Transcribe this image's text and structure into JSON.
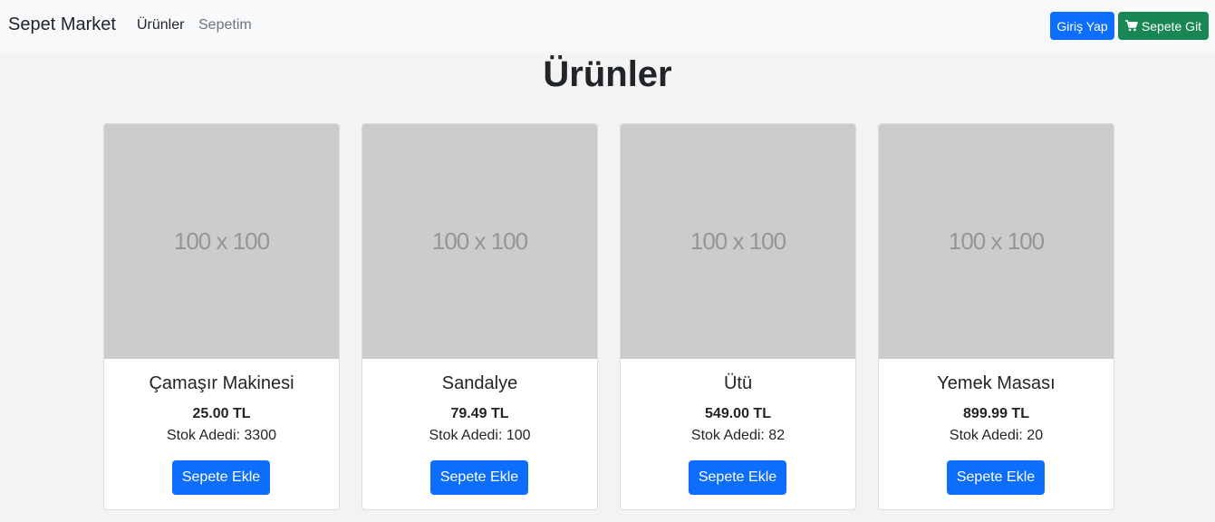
{
  "navbar": {
    "brand": "Sepet Market",
    "links": [
      {
        "label": "Ürünler",
        "active": true
      },
      {
        "label": "Sepetim",
        "active": false
      }
    ],
    "login_label": "Giriş Yap",
    "cart_label": "Sepete Git",
    "cart_icon": "shopping-cart-icon"
  },
  "main": {
    "title": "Ürünler",
    "products": [
      {
        "image_text": "100 x 100",
        "name": "Çamaşır Makinesi",
        "price": "25.00 TL",
        "stock": "Stok Adedi: 3300",
        "button": "Sepete Ekle"
      },
      {
        "image_text": "100 x 100",
        "name": "Sandalye",
        "price": "79.49 TL",
        "stock": "Stok Adedi: 100",
        "button": "Sepete Ekle"
      },
      {
        "image_text": "100 x 100",
        "name": "Ütü",
        "price": "549.00 TL",
        "stock": "Stok Adedi: 82",
        "button": "Sepete Ekle"
      },
      {
        "image_text": "100 x 100",
        "name": "Yemek Masası",
        "price": "899.99 TL",
        "stock": "Stok Adedi: 20",
        "button": "Sepete Ekle"
      }
    ]
  },
  "colors": {
    "primary": "#0d6efd",
    "success": "#198754",
    "navbar_bg": "#f8f9fa",
    "page_bg": "#f3f3f3",
    "placeholder_bg": "#cccccc"
  }
}
